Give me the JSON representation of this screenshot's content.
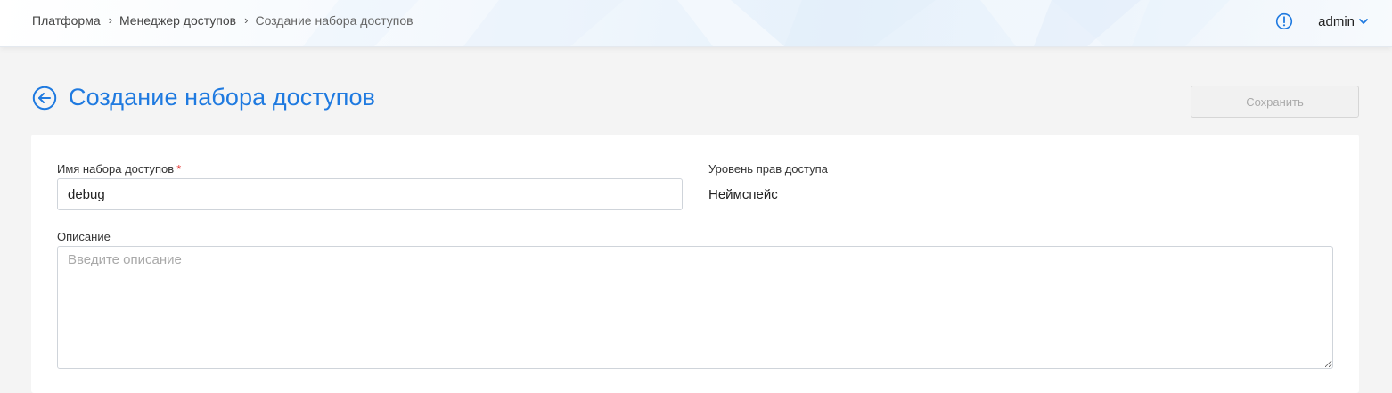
{
  "breadcrumb": {
    "items": [
      "Платформа",
      "Менеджер доступов",
      "Создание набора доступов"
    ]
  },
  "header": {
    "user_name": "admin",
    "icons": {
      "alert": "exclamation-circle-icon",
      "dropdown": "chevron-down-icon"
    }
  },
  "page": {
    "title": "Создание набора доступов",
    "back_icon": "arrow-left-circle-icon",
    "save_label": "Сохранить"
  },
  "form": {
    "name": {
      "label": "Имя набора доступов",
      "required_mark": "*",
      "value": "debug"
    },
    "access_level": {
      "label": "Уровень прав доступа",
      "value": "Неймспейс"
    },
    "description": {
      "label": "Описание",
      "placeholder": "Введите описание",
      "value": ""
    }
  },
  "colors": {
    "accent": "#1f7ae0",
    "required": "#e53935",
    "disabled_text": "#aaaaaa"
  }
}
